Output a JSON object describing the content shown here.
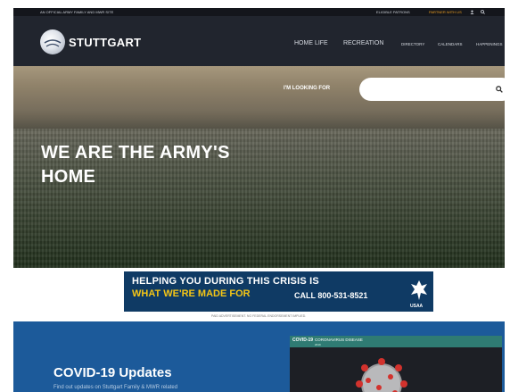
{
  "topbar": {
    "official": "AN OFFICIAL ARMY FAMILY AND MWR SITE",
    "eligible": "ELIGIBLE PATRONS",
    "partner": "PARTNER WITH US"
  },
  "header": {
    "logo_text": "STUTTGART",
    "nav_primary": [
      "HOME LIFE",
      "RECREATION"
    ],
    "nav_secondary": [
      "DIRECTORY",
      "CALENDARS",
      "HAPPENINGS"
    ]
  },
  "hero": {
    "looking_label": "I'M LOOKING FOR",
    "search_placeholder": "",
    "title_line1": "WE ARE THE ARMY'S",
    "title_line2": "HOME"
  },
  "ad": {
    "line1": "HELPING YOU DURING THIS CRISIS IS",
    "line2": "WHAT WE'RE MADE FOR",
    "call": "CALL 800-531-8521",
    "brand": "USAA",
    "fine_print": "",
    "disclaimer": "PAID ADVERTISEMENT. NO FEDERAL ENDORSEMENT IMPLIED."
  },
  "covid": {
    "title": "COVID-19 Updates",
    "subtitle": "Find out updates on Stuttgart Family & MWR related",
    "image_logo": "COVID-19",
    "image_caption": "CORONAVIRUS DISEASE",
    "image_caption2": "2019"
  },
  "colors": {
    "header_bg": "#21252e",
    "accent_orange": "#f0a020",
    "ad_blue": "#0f3a64",
    "ad_yellow": "#f4c516",
    "covid_blue": "#1c5a9a"
  },
  "icons": [
    "user-icon",
    "search-icon",
    "stuttgart-logo",
    "usaa-eagle-logo",
    "coronavirus-image"
  ]
}
